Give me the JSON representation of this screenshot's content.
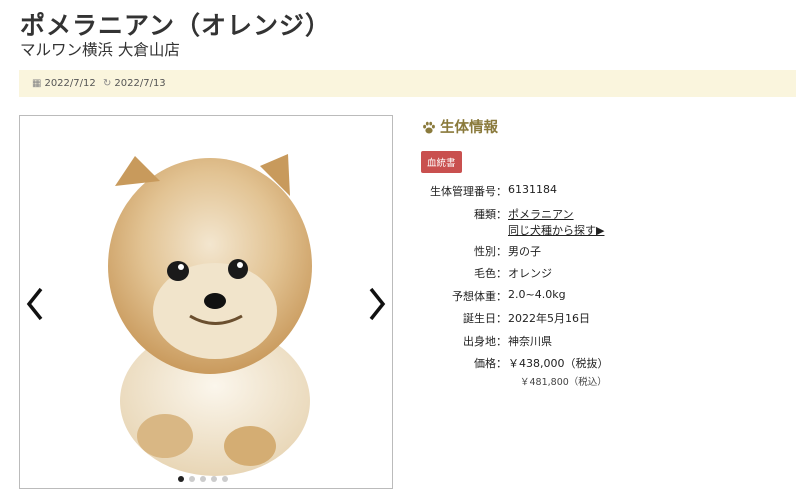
{
  "page": {
    "title": "ポメラニアン（オレンジ）",
    "shop": "マルワン横浜 大倉山店"
  },
  "dates": {
    "posted": "2022/7/12",
    "updated": "2022/7/13"
  },
  "gallery": {
    "dot_count": 5,
    "active_index": 0
  },
  "section": {
    "title": "生体情報",
    "badge": "血統書"
  },
  "info": {
    "id_label": "生体管理番号：",
    "id_value": "6131184",
    "breed_label": "種類：",
    "breed_value": "ポメラニアン",
    "breed_search": "同じ犬種から探す▶",
    "sex_label": "性別：",
    "sex_value": "男の子",
    "color_label": "毛色：",
    "color_value": "オレンジ",
    "weight_label": "予想体重：",
    "weight_value": "2.0~4.0kg",
    "birth_label": "誕生日：",
    "birth_value": "2022年5月16日",
    "origin_label": "出身地：",
    "origin_value": "神奈川県",
    "price_label": "価格：",
    "price_excl": "￥438,000（税抜）",
    "price_incl": "￥481,800（税込）"
  },
  "colors": {
    "accent": "#8a7a3c",
    "badge": "#c9504f",
    "datebar_bg": "#faf5dd"
  }
}
